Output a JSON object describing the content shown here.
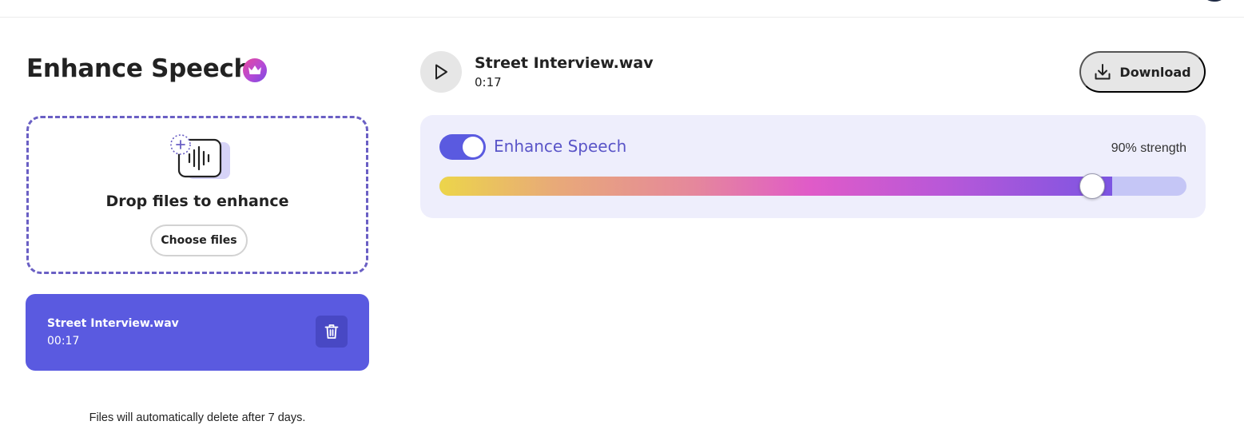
{
  "header": {
    "title": "Enhance Speech"
  },
  "upload": {
    "drop_text": "Drop files to enhance",
    "choose_label": "Choose files"
  },
  "files": [
    {
      "name": "Street Interview.wav",
      "duration": "00:17"
    }
  ],
  "notice": "Files will automatically delete after 7 days.",
  "player": {
    "track_name": "Street Interview.wav",
    "duration": "0:17",
    "download_label": "Download"
  },
  "enhance": {
    "label": "Enhance Speech",
    "enabled": true,
    "strength_text": "90% strength",
    "strength_value": 0.9
  },
  "colors": {
    "accent": "#5a5ae0",
    "panel_bg": "#eeeefc",
    "dropzone_border": "#6a5fc4"
  },
  "icons": {
    "premium": "crown-icon",
    "upload": "audio-file-add-icon",
    "delete": "trash-icon",
    "play": "play-icon",
    "download": "download-icon"
  }
}
